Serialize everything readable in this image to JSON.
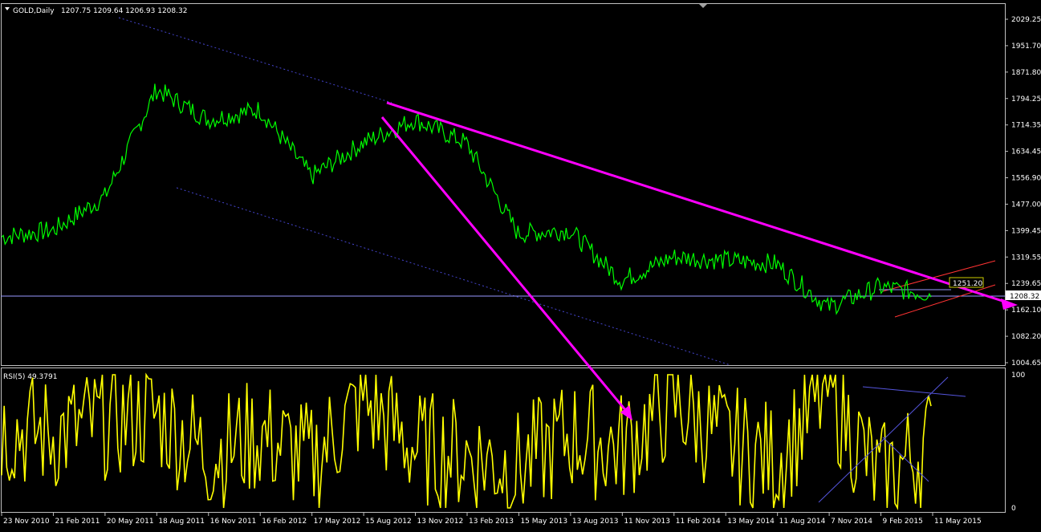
{
  "header": {
    "symbol": "GOLD,Daily",
    "ohlc": "1207.75 1209.64 1206.93 1208.32",
    "menu_icon": "triangle-down-icon"
  },
  "colors": {
    "background": "#000000",
    "price_line": "#00ff00",
    "rsi_line": "#ffff00",
    "trend_magenta": "#ff00ff",
    "channel_red": "#ff3333",
    "channel_blue_dotted": "#4444cc",
    "hline": "#9999ff",
    "axis_text": "#ffffff",
    "price_label_bg": "#000000",
    "price_label_border": "#cccc00"
  },
  "price_axis": {
    "ticks": [
      "2029.25",
      "1951.70",
      "1871.80",
      "1794.25",
      "1714.35",
      "1634.45",
      "1556.90",
      "1477.00",
      "1399.45",
      "1319.55",
      "1239.65",
      "1162.10",
      "1082.20",
      "1004.65"
    ],
    "ylim": [
      1004.65,
      2029.25
    ],
    "current_price": "1208.32",
    "annotation_price": "1251.20"
  },
  "rsi_panel": {
    "label": "RSI(5) 49.3791",
    "ticks": [
      "100",
      "0"
    ],
    "ylim": [
      0,
      100
    ]
  },
  "x_axis": {
    "labels": [
      "23 Nov 2010",
      "21 Feb 2011",
      "20 May 2011",
      "18 Aug 2011",
      "16 Nov 2011",
      "16 Feb 2012",
      "17 May 2012",
      "15 Aug 2012",
      "13 Nov 2012",
      "13 Feb 2013",
      "15 May 2013",
      "13 Aug 2013",
      "11 Nov 2013",
      "11 Feb 2014",
      "13 May 2014",
      "11 Aug 2014",
      "7 Nov 2014",
      "9 Feb 2015",
      "11 May 2015"
    ]
  },
  "chart_data": [
    {
      "type": "line",
      "name": "GOLD,Daily",
      "x": [
        "23 Nov 2010",
        "21 Feb 2011",
        "20 May 2011",
        "18 Aug 2011",
        "16 Nov 2011",
        "16 Feb 2012",
        "17 May 2012",
        "15 Aug 2012",
        "13 Nov 2012",
        "13 Feb 2013",
        "15 May 2013",
        "13 Aug 2013",
        "11 Nov 2013",
        "11 Feb 2014",
        "13 May 2014",
        "11 Aug 2014",
        "7 Nov 2014",
        "9 Feb 2015",
        "11 May 2015"
      ],
      "series": [
        {
          "values": [
            1380,
            1400,
            1500,
            1820,
            1730,
            1760,
            1560,
            1660,
            1730,
            1660,
            1390,
            1400,
            1250,
            1320,
            1310,
            1300,
            1170,
            1230,
            1210
          ]
        }
      ],
      "ylim": [
        1004.65,
        2029.25
      ],
      "last_value": 1208.32,
      "annotations": [
        "1251.20"
      ]
    },
    {
      "type": "line",
      "name": "RSI(5) 49.3791",
      "x": [
        "23 Nov 2010",
        "21 Feb 2011",
        "20 May 2011",
        "18 Aug 2011",
        "16 Nov 2011",
        "16 Feb 2012",
        "17 May 2012",
        "15 Aug 2012",
        "13 Nov 2012",
        "13 Feb 2013",
        "15 May 2013",
        "13 Aug 2013",
        "11 Nov 2013",
        "11 Feb 2014",
        "13 May 2014",
        "11 Aug 2014",
        "7 Nov 2014",
        "9 Feb 2015",
        "11 May 2015"
      ],
      "series": [
        {
          "values": [
            60,
            55,
            65,
            70,
            40,
            55,
            35,
            80,
            45,
            40,
            30,
            55,
            45,
            80,
            50,
            35,
            90,
            20,
            49.38
          ]
        }
      ],
      "ylim": [
        0,
        100
      ],
      "last_value": 49.3791
    }
  ]
}
